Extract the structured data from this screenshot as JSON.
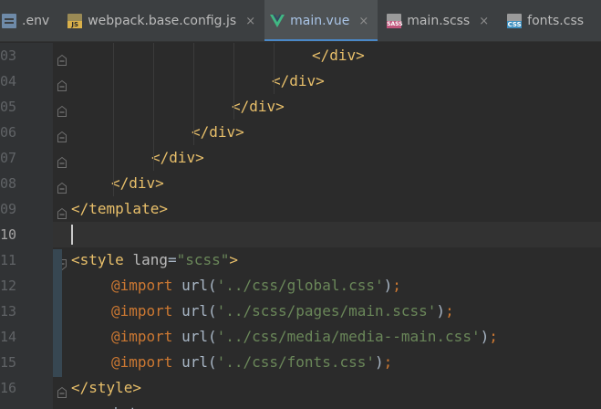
{
  "tabs": [
    {
      "icon": "env-file-icon",
      "label": ".env",
      "active": false
    },
    {
      "icon": "js-file-icon",
      "icon_text": "JS",
      "label": "webpack.base.config.js",
      "active": false,
      "close": "×"
    },
    {
      "icon": "vue-file-icon",
      "label": "main.vue",
      "active": true,
      "close": "×"
    },
    {
      "icon": "sass-file-icon",
      "icon_text": "SASS",
      "label": "main.scss",
      "active": false,
      "close": "×"
    },
    {
      "icon": "css-file-icon",
      "icon_text": "CSS",
      "label": "fonts.css",
      "active": false
    }
  ],
  "editor": {
    "lines": [
      {
        "num": "03",
        "code": [
          {
            "t": "tag",
            "v": "</div>"
          }
        ]
      },
      {
        "num": "04",
        "code": [
          {
            "t": "tag",
            "v": "</div>"
          }
        ]
      },
      {
        "num": "05",
        "code": [
          {
            "t": "tag",
            "v": "</div>"
          }
        ]
      },
      {
        "num": "06",
        "code": [
          {
            "t": "tag",
            "v": "</div>"
          }
        ]
      },
      {
        "num": "07",
        "code": [
          {
            "t": "tag",
            "v": "</div>"
          }
        ]
      },
      {
        "num": "08",
        "code": [
          {
            "t": "tag",
            "v": "</div>"
          }
        ]
      },
      {
        "num": "09",
        "code": [
          {
            "t": "tag",
            "v": "</template>"
          }
        ]
      },
      {
        "num": "10",
        "code": []
      },
      {
        "num": "11",
        "code": [
          {
            "t": "tag",
            "v": "<style "
          },
          {
            "t": "attr",
            "v": "lang"
          },
          {
            "t": "plain",
            "v": "="
          },
          {
            "t": "str",
            "v": "\"scss\""
          },
          {
            "t": "tag",
            "v": ">"
          }
        ]
      },
      {
        "num": "12",
        "code": [
          {
            "t": "kw",
            "v": "@import "
          },
          {
            "t": "fn",
            "v": "url("
          },
          {
            "t": "str",
            "v": "'../css/global.css'"
          },
          {
            "t": "fn",
            "v": ")"
          },
          {
            "t": "kw",
            "v": ";"
          }
        ]
      },
      {
        "num": "13",
        "code": [
          {
            "t": "kw",
            "v": "@import "
          },
          {
            "t": "fn",
            "v": "url("
          },
          {
            "t": "str",
            "v": "'../scss/pages/main.scss'"
          },
          {
            "t": "fn",
            "v": ")"
          },
          {
            "t": "kw",
            "v": ";"
          }
        ]
      },
      {
        "num": "14",
        "code": [
          {
            "t": "kw",
            "v": "@import "
          },
          {
            "t": "fn",
            "v": "url("
          },
          {
            "t": "str",
            "v": "'../css/media/media--main.css'"
          },
          {
            "t": "fn",
            "v": ")"
          },
          {
            "t": "kw",
            "v": ";"
          }
        ]
      },
      {
        "num": "15",
        "code": [
          {
            "t": "kw",
            "v": "@import "
          },
          {
            "t": "fn",
            "v": "url("
          },
          {
            "t": "str",
            "v": "'../css/fonts.css'"
          },
          {
            "t": "fn",
            "v": ")"
          },
          {
            "t": "kw",
            "v": ";"
          }
        ]
      },
      {
        "num": "16",
        "code": [
          {
            "t": "tag",
            "v": "</style>"
          }
        ]
      },
      {
        "num": "",
        "code": [
          {
            "t": "plain",
            "v": "int"
          }
        ]
      }
    ],
    "current_line": "10"
  }
}
